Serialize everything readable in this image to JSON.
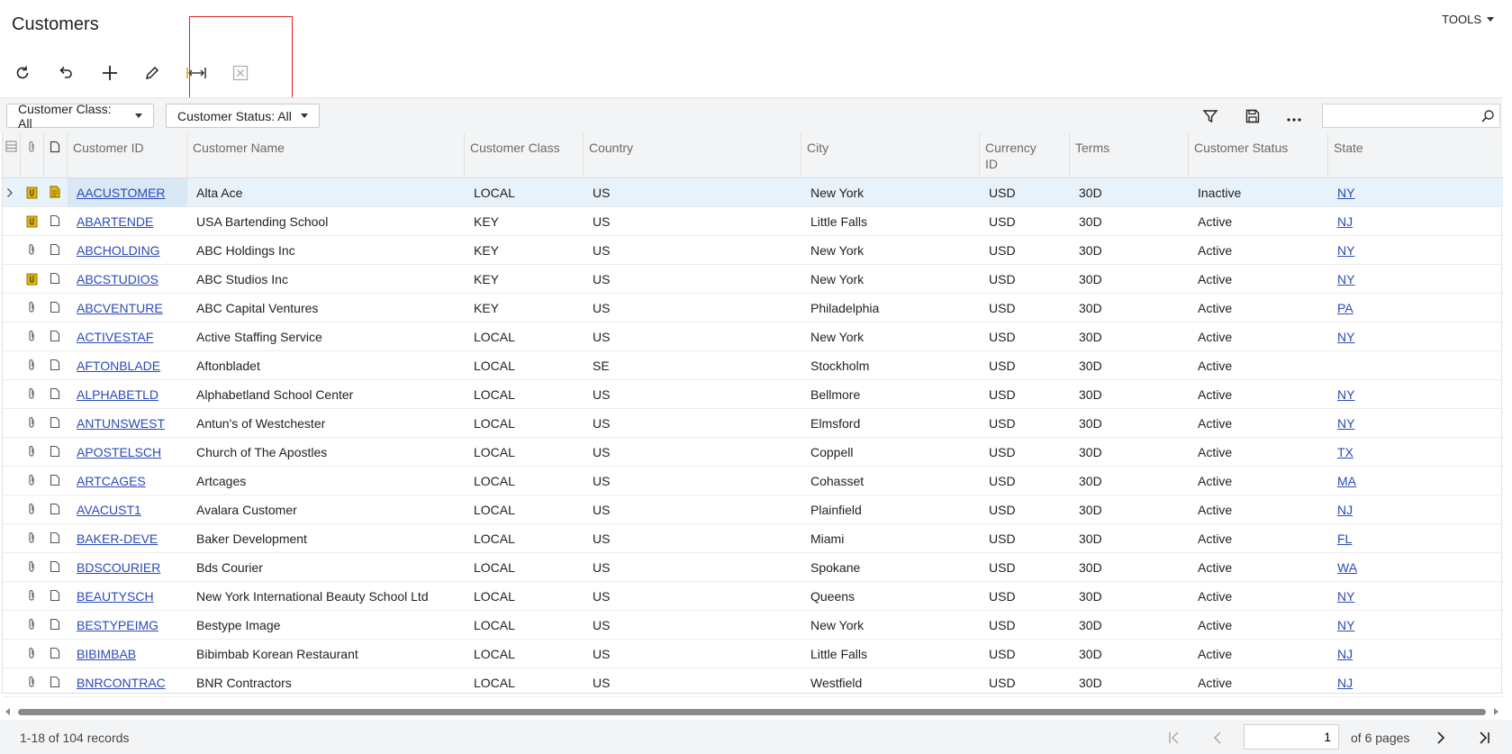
{
  "header": {
    "title": "Customers",
    "tools_label": "TOOLS"
  },
  "toolbar": {
    "buttons": [
      "refresh-icon",
      "undo-icon",
      "add-icon",
      "edit-icon",
      "fit-columns-icon",
      "excel-export-icon"
    ]
  },
  "filters": {
    "class_filter": "Customer Class: All",
    "status_filter": "Customer Status: All",
    "search_placeholder": ""
  },
  "columns": {
    "id": "Customer ID",
    "name": "Customer Name",
    "class": "Customer Class",
    "country": "Country",
    "city": "City",
    "currency_1": "Currency",
    "currency_2": "ID",
    "terms": "Terms",
    "status": "Customer Status",
    "state": "State"
  },
  "rows": [
    {
      "id": "AACUSTOMER",
      "name": "Alta Ace",
      "class": "LOCAL",
      "country": "US",
      "city": "New York",
      "currency": "USD",
      "terms": "30D",
      "status": "Inactive",
      "state": "NY"
    },
    {
      "id": "ABARTENDE",
      "name": "USA Bartending School",
      "class": "KEY",
      "country": "US",
      "city": "Little Falls",
      "currency": "USD",
      "terms": "30D",
      "status": "Active",
      "state": "NJ"
    },
    {
      "id": "ABCHOLDING",
      "name": "ABC Holdings Inc",
      "class": "KEY",
      "country": "US",
      "city": "New York",
      "currency": "USD",
      "terms": "30D",
      "status": "Active",
      "state": "NY"
    },
    {
      "id": "ABCSTUDIOS",
      "name": "ABC Studios Inc",
      "class": "KEY",
      "country": "US",
      "city": "New York",
      "currency": "USD",
      "terms": "30D",
      "status": "Active",
      "state": "NY"
    },
    {
      "id": "ABCVENTURE",
      "name": "ABC Capital Ventures",
      "class": "KEY",
      "country": "US",
      "city": "Philadelphia",
      "currency": "USD",
      "terms": "30D",
      "status": "Active",
      "state": "PA"
    },
    {
      "id": "ACTIVESTAF",
      "name": "Active Staffing Service",
      "class": "LOCAL",
      "country": "US",
      "city": "New York",
      "currency": "USD",
      "terms": "30D",
      "status": "Active",
      "state": "NY"
    },
    {
      "id": "AFTONBLADE",
      "name": "Aftonbladet",
      "class": "LOCAL",
      "country": "SE",
      "city": "Stockholm",
      "currency": "USD",
      "terms": "30D",
      "status": "Active",
      "state": ""
    },
    {
      "id": "ALPHABETLD",
      "name": "Alphabetland School Center",
      "class": "LOCAL",
      "country": "US",
      "city": "Bellmore",
      "currency": "USD",
      "terms": "30D",
      "status": "Active",
      "state": "NY"
    },
    {
      "id": "ANTUNSWEST",
      "name": "Antun's of Westchester",
      "class": "LOCAL",
      "country": "US",
      "city": "Elmsford",
      "currency": "USD",
      "terms": "30D",
      "status": "Active",
      "state": "NY"
    },
    {
      "id": "APOSTELSCH",
      "name": "Church of The Apostles",
      "class": "LOCAL",
      "country": "US",
      "city": "Coppell",
      "currency": "USD",
      "terms": "30D",
      "status": "Active",
      "state": "TX"
    },
    {
      "id": "ARTCAGES",
      "name": "Artcages",
      "class": "LOCAL",
      "country": "US",
      "city": "Cohasset",
      "currency": "USD",
      "terms": "30D",
      "status": "Active",
      "state": "MA"
    },
    {
      "id": "AVACUST1",
      "name": "Avalara Customer",
      "class": "LOCAL",
      "country": "US",
      "city": "Plainfield",
      "currency": "USD",
      "terms": "30D",
      "status": "Active",
      "state": "NJ"
    },
    {
      "id": "BAKER-DEVE",
      "name": "Baker Development",
      "class": "LOCAL",
      "country": "US",
      "city": "Miami",
      "currency": "USD",
      "terms": "30D",
      "status": "Active",
      "state": "FL"
    },
    {
      "id": "BDSCOURIER",
      "name": "Bds Courier",
      "class": "LOCAL",
      "country": "US",
      "city": "Spokane",
      "currency": "USD",
      "terms": "30D",
      "status": "Active",
      "state": "WA"
    },
    {
      "id": "BEAUTYSCH",
      "name": "New York International Beauty School Ltd",
      "class": "LOCAL",
      "country": "US",
      "city": "Queens",
      "currency": "USD",
      "terms": "30D",
      "status": "Active",
      "state": "NY"
    },
    {
      "id": "BESTYPEIMG",
      "name": "Bestype Image",
      "class": "LOCAL",
      "country": "US",
      "city": "New York",
      "currency": "USD",
      "terms": "30D",
      "status": "Active",
      "state": "NY"
    },
    {
      "id": "BIBIMBAB",
      "name": "Bibimbab Korean Restaurant",
      "class": "LOCAL",
      "country": "US",
      "city": "Little Falls",
      "currency": "USD",
      "terms": "30D",
      "status": "Active",
      "state": "NJ"
    },
    {
      "id": "BNRCONTRAC",
      "name": "BNR Contractors",
      "class": "LOCAL",
      "country": "US",
      "city": "Westfield",
      "currency": "USD",
      "terms": "30D",
      "status": "Active",
      "state": "NJ"
    }
  ],
  "pager": {
    "records": "1-18 of 104 records",
    "current_page": "1",
    "of_pages": "of 6 pages"
  },
  "colors": {
    "link": "#2b4ab8",
    "selected_row": "#e7f2fa",
    "highlight_box": "#dd2222",
    "note_yellow": "#e6b800"
  }
}
